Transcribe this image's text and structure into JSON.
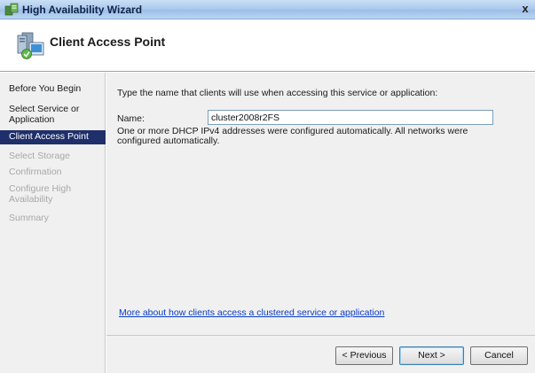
{
  "window": {
    "title": "High Availability Wizard",
    "close_glyph": "x",
    "icon": "cluster-wizard-icon"
  },
  "header": {
    "title": "Client Access Point",
    "icon": "client-access-point-icon"
  },
  "sidebar": {
    "steps": [
      {
        "label": "Before You Begin",
        "state": "done"
      },
      {
        "label": "Select Service or Application",
        "state": "done"
      },
      {
        "label": "Client Access Point",
        "state": "current"
      },
      {
        "label": "Select Storage",
        "state": "pending"
      },
      {
        "label": "Confirmation",
        "state": "pending"
      },
      {
        "label": "Configure High Availability",
        "state": "pending"
      },
      {
        "label": "Summary",
        "state": "pending"
      }
    ]
  },
  "main": {
    "instruction": "Type the name that clients will use when accessing this service or application:",
    "name_label": "Name:",
    "name_value": "cluster2008r2FS",
    "dhcp_note": "One or more DHCP IPv4 addresses were configured automatically.  All networks were configured automatically.",
    "help_link": "More about how clients access a clustered service or application"
  },
  "footer": {
    "previous_label": "< Previous",
    "next_label": "Next >",
    "cancel_label": "Cancel"
  },
  "colors": {
    "current_step_bg": "#1f2f6b",
    "link": "#0a3cc8",
    "pending_step": "#a8a8a8"
  }
}
